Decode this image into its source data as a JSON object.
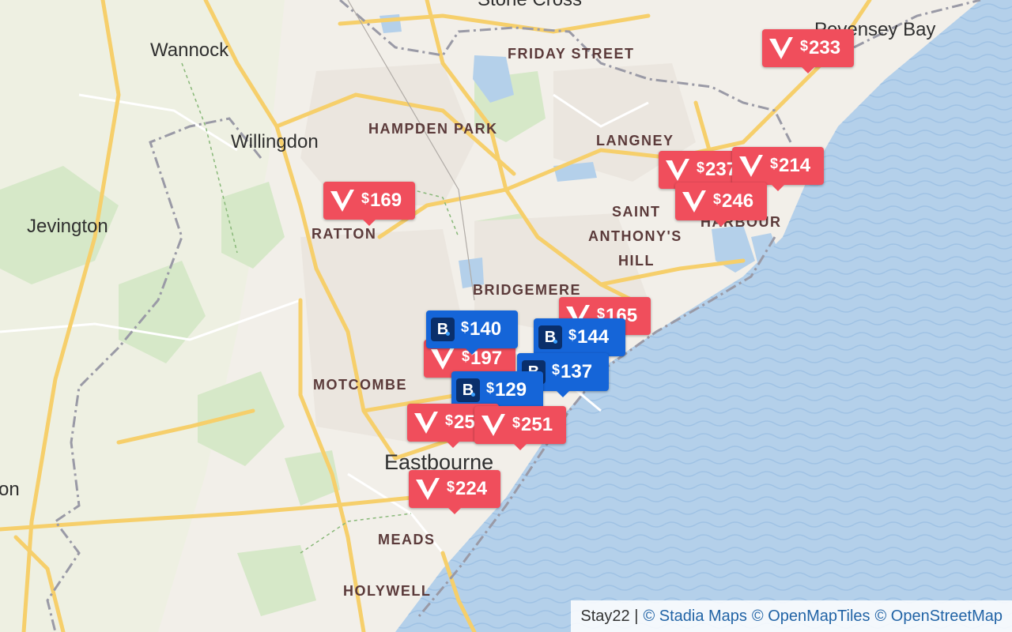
{
  "places": [
    {
      "id": "stone-cross",
      "label": "Stone Cross",
      "kind": "town"
    },
    {
      "id": "pevensey-bay",
      "label": "Pevensey Bay",
      "kind": "town"
    },
    {
      "id": "wannock",
      "label": "Wannock",
      "kind": "town"
    },
    {
      "id": "friday-street",
      "label": "FRIDAY STREET",
      "kind": "district"
    },
    {
      "id": "hampden-park",
      "label": "HAMPDEN PARK",
      "kind": "district"
    },
    {
      "id": "willingdon",
      "label": "Willingdon",
      "kind": "town"
    },
    {
      "id": "langney",
      "label": "LANGNEY",
      "kind": "district"
    },
    {
      "id": "jevington",
      "label": "Jevington",
      "kind": "town"
    },
    {
      "id": "ratton",
      "label": "RATTON",
      "kind": "district"
    },
    {
      "id": "saint",
      "label": "SAINT",
      "kind": "district"
    },
    {
      "id": "anthonys",
      "label": "ANTHONY'S",
      "kind": "district"
    },
    {
      "id": "hill",
      "label": "HILL",
      "kind": "district"
    },
    {
      "id": "harbour",
      "label": "HARBOUR",
      "kind": "district"
    },
    {
      "id": "bridgemere",
      "label": "BRIDGEMERE",
      "kind": "district"
    },
    {
      "id": "motcombe",
      "label": "MOTCOMBE",
      "kind": "district"
    },
    {
      "id": "eastbourne",
      "label": "Eastbourne",
      "kind": "town"
    },
    {
      "id": "meads",
      "label": "MEADS",
      "kind": "district"
    },
    {
      "id": "holywell",
      "label": "HOLYWELL",
      "kind": "district"
    },
    {
      "id": "on",
      "label": "on",
      "kind": "town"
    }
  ],
  "markers": [
    {
      "id": "v233",
      "provider": "vrbo",
      "price": "233"
    },
    {
      "id": "v169",
      "provider": "vrbo",
      "price": "169"
    },
    {
      "id": "v237",
      "provider": "vrbo",
      "price": "237"
    },
    {
      "id": "v214",
      "provider": "vrbo",
      "price": "214"
    },
    {
      "id": "v246",
      "provider": "vrbo",
      "price": "246"
    },
    {
      "id": "v165",
      "provider": "vrbo",
      "price": "165"
    },
    {
      "id": "v197",
      "provider": "vrbo",
      "price": "197"
    },
    {
      "id": "b140",
      "provider": "booking",
      "price": "140"
    },
    {
      "id": "b144",
      "provider": "booking",
      "price": "144"
    },
    {
      "id": "b137",
      "provider": "booking",
      "price": "137"
    },
    {
      "id": "b129",
      "provider": "booking",
      "price": "129"
    },
    {
      "id": "v251a",
      "provider": "vrbo",
      "price": "251"
    },
    {
      "id": "v251b",
      "provider": "vrbo",
      "price": "251"
    },
    {
      "id": "v224",
      "provider": "vrbo",
      "price": "224"
    }
  ],
  "currency_symbol": "$",
  "icons": {
    "vrbo": "vrbo-logo-icon",
    "booking": "booking-logo-icon"
  },
  "colors": {
    "vrbo": "#f04e5c",
    "booking": "#1565d8",
    "sea": "#b4d0ea",
    "land": "#f2efe9",
    "road": "#f6cf6b"
  },
  "attribution": {
    "prefix": "Stay22 |",
    "links": [
      "© Stadia Maps",
      "© OpenMapTiles",
      "© OpenStreetMap"
    ]
  }
}
